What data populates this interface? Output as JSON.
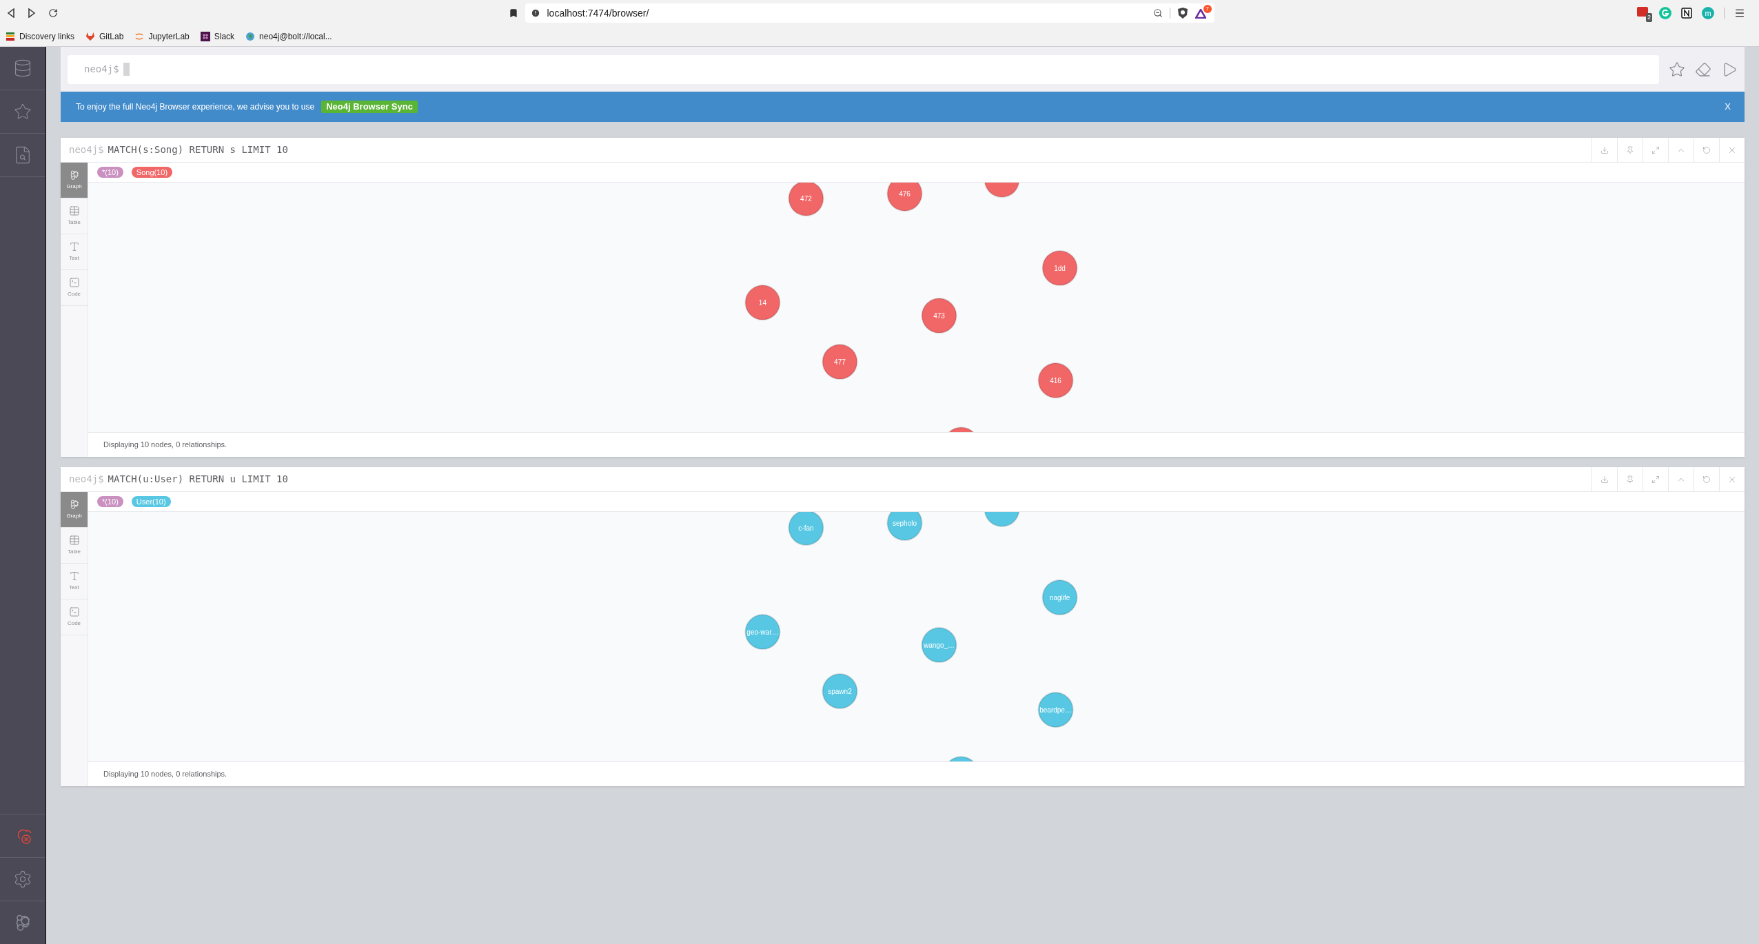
{
  "browser": {
    "url": "localhost:7474/browser/",
    "shield_badge": "7",
    "bookmarks": [
      "Discovery links",
      "GitLab",
      "JupyterLab",
      "Slack",
      "neo4j@bolt://local..."
    ],
    "extension_badge": "2",
    "avatar": "m"
  },
  "editor": {
    "prompt": "neo4j$"
  },
  "banner": {
    "text": "To enjoy the full Neo4j Browser experience, we advise you to use",
    "button": "Neo4j Browser Sync",
    "close": "X"
  },
  "frames": [
    {
      "prompt": "neo4j$",
      "query": "MATCH(s:Song) RETURN s LIMIT 10",
      "legend": [
        {
          "label": "*(10)",
          "color": "#c990c0"
        },
        {
          "label": "Song(10)",
          "color": "#f16667"
        }
      ],
      "view_tabs": [
        {
          "label": "Graph",
          "selected": true
        },
        {
          "label": "Table",
          "selected": false
        },
        {
          "label": "Text",
          "selected": false
        },
        {
          "label": "Code",
          "selected": false
        }
      ],
      "nodes": [
        "472",
        "476",
        "1dd",
        "14",
        "473",
        "477",
        "416"
      ],
      "status": "Displaying 10 nodes, 0 relationships."
    },
    {
      "prompt": "neo4j$",
      "query": "MATCH(u:User) RETURN u LIMIT 10",
      "legend": [
        {
          "label": "*(10)",
          "color": "#c990c0"
        },
        {
          "label": "User(10)",
          "color": "#57c7e3"
        }
      ],
      "view_tabs": [
        {
          "label": "Graph",
          "selected": true
        },
        {
          "label": "Table",
          "selected": false
        },
        {
          "label": "Text",
          "selected": false
        },
        {
          "label": "Code",
          "selected": false
        }
      ],
      "nodes": [
        "c-fan",
        "sepholo",
        "naglife",
        "geo-war…",
        "wango_…",
        "spawn2",
        "beardpe…"
      ],
      "status": "Displaying 10 nodes, 0 relationships."
    }
  ]
}
